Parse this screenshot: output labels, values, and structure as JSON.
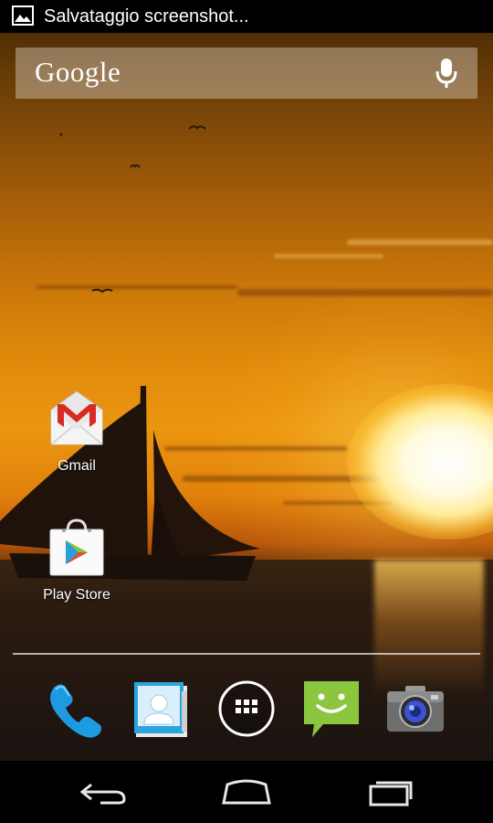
{
  "status_bar": {
    "notification_icon": "image-icon",
    "text": "Salvataggio screenshot..."
  },
  "search_widget": {
    "logo": "Google",
    "voice_icon": "microphone-icon"
  },
  "desktop_apps": [
    {
      "label": "Gmail",
      "icon": "gmail-icon"
    },
    {
      "label": "Play Store",
      "icon": "play-store-icon"
    }
  ],
  "dock": [
    {
      "icon": "phone-icon"
    },
    {
      "icon": "contacts-icon"
    },
    {
      "icon": "all-apps-icon"
    },
    {
      "icon": "messaging-icon"
    },
    {
      "icon": "camera-icon"
    }
  ],
  "nav_bar": {
    "back_icon": "back-icon",
    "home_icon": "home-icon",
    "recents_icon": "recent-apps-icon"
  },
  "colors": {
    "gmail_red": "#d82b23",
    "play_green": "#2db24a",
    "phone_blue": "#1e9be0",
    "messaging_green": "#8cc63e"
  }
}
